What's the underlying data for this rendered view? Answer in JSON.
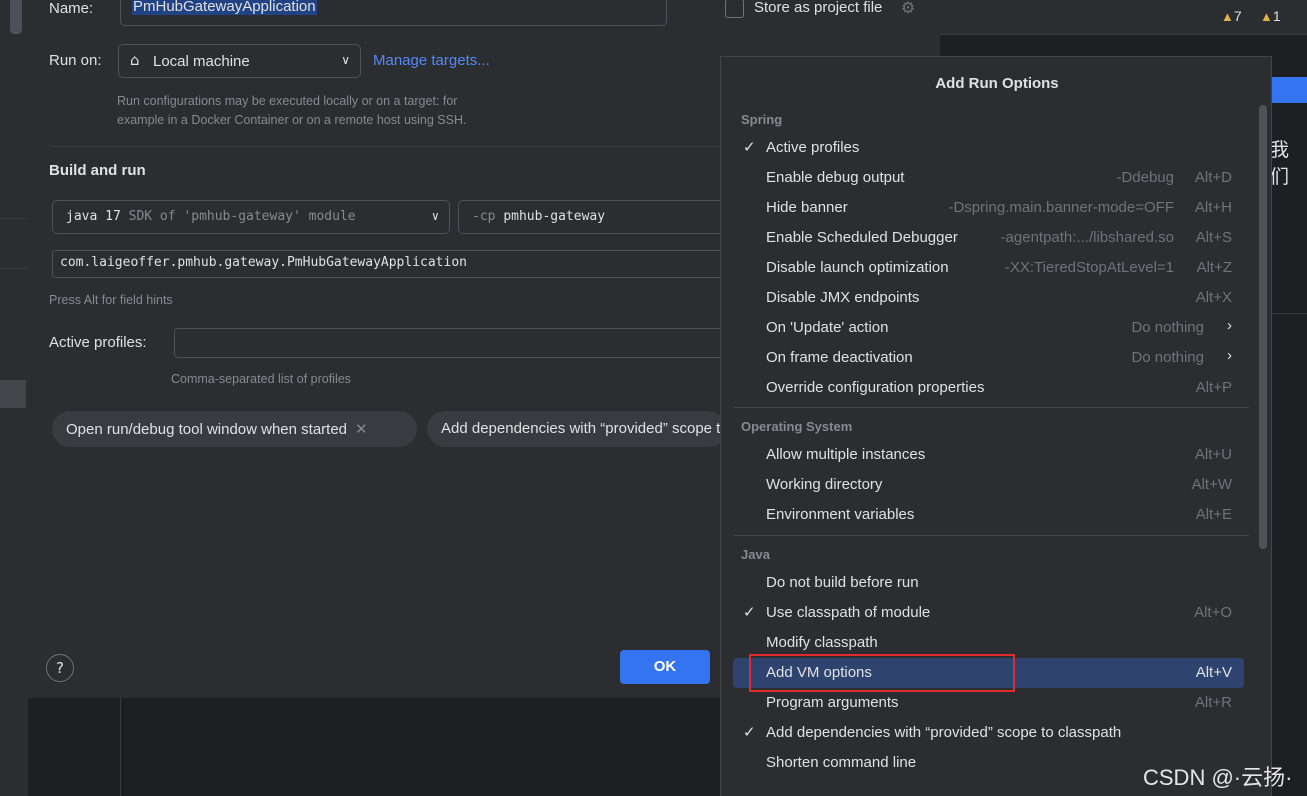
{
  "dialog": {
    "name_label": "Name:",
    "name_value": "PmHubGatewayApplication",
    "store_label": "Store as project file",
    "run_on_label": "Run on:",
    "run_on_value": "Local machine",
    "manage_targets": "Manage targets...",
    "run_on_hint_1": "Run configurations may be executed locally or on a target: for",
    "run_on_hint_2": "example in a Docker Container or on a remote host using SSH.",
    "build_and_run": "Build and run",
    "sdk_java": "java 17",
    "sdk_desc": "SDK of 'pmhub-gateway' module",
    "cp_flag": "-cp",
    "cp_value": "pmhub-gateway",
    "main_class": "com.laigeoffer.pmhub.gateway.PmHubGatewayApplication",
    "field_hint": "Press Alt for field hints",
    "active_profiles_label": "Active profiles:",
    "profiles_hint": "Comma-separated list of profiles",
    "chip_1": "Open run/debug tool window when started",
    "chip_2": "Add dependencies with “provided” scope to classpath",
    "help": "?",
    "ok": "OK"
  },
  "ide": {
    "warnings": "7",
    "weak_warnings": "1",
    "cn_text": "我们",
    "watermark": "CSDN @·云扬·"
  },
  "popup": {
    "title": "Add Run Options",
    "groups": [
      {
        "name": "Spring",
        "items": [
          {
            "label": "Active profiles",
            "checked": true,
            "hint": "",
            "shortcut": ""
          },
          {
            "label": "Enable debug output",
            "checked": false,
            "hint": "-Ddebug",
            "shortcut": "Alt+D"
          },
          {
            "label": "Hide banner",
            "checked": false,
            "hint": "-Dspring.main.banner-mode=OFF",
            "shortcut": "Alt+H"
          },
          {
            "label": "Enable Scheduled Debugger",
            "checked": false,
            "hint": "-agentpath:.../libshared.so",
            "shortcut": "Alt+S"
          },
          {
            "label": "Disable launch optimization",
            "checked": false,
            "hint": "-XX:TieredStopAtLevel=1",
            "shortcut": "Alt+Z"
          },
          {
            "label": "Disable JMX endpoints",
            "checked": false,
            "hint": "",
            "shortcut": "Alt+X"
          },
          {
            "label": "On 'Update' action",
            "checked": false,
            "hint": "Do nothing",
            "shortcut": "",
            "submenu": true
          },
          {
            "label": "On frame deactivation",
            "checked": false,
            "hint": "Do nothing",
            "shortcut": "",
            "submenu": true
          },
          {
            "label": "Override configuration properties",
            "checked": false,
            "hint": "",
            "shortcut": "Alt+P"
          }
        ]
      },
      {
        "name": "Operating System",
        "items": [
          {
            "label": "Allow multiple instances",
            "checked": false,
            "hint": "",
            "shortcut": "Alt+U"
          },
          {
            "label": "Working directory",
            "checked": false,
            "hint": "",
            "shortcut": "Alt+W"
          },
          {
            "label": "Environment variables",
            "checked": false,
            "hint": "",
            "shortcut": "Alt+E"
          }
        ]
      },
      {
        "name": "Java",
        "items": [
          {
            "label": "Do not build before run",
            "checked": false,
            "hint": "",
            "shortcut": ""
          },
          {
            "label": "Use classpath of module",
            "checked": true,
            "hint": "",
            "shortcut": "Alt+O"
          },
          {
            "label": "Modify classpath",
            "checked": false,
            "hint": "",
            "shortcut": ""
          },
          {
            "label": "Add VM options",
            "checked": false,
            "hint": "",
            "shortcut": "Alt+V",
            "selected": true
          },
          {
            "label": "Program arguments",
            "checked": false,
            "hint": "",
            "shortcut": "Alt+R"
          },
          {
            "label": "Add dependencies with “provided” scope to classpath",
            "checked": true,
            "hint": "",
            "shortcut": ""
          },
          {
            "label": "Shorten command line",
            "checked": false,
            "hint": "",
            "shortcut": ""
          }
        ]
      }
    ]
  },
  "colors": {
    "accent": "#3574f0",
    "selection": "#2e436e",
    "highlight_box": "#e02b2b"
  }
}
